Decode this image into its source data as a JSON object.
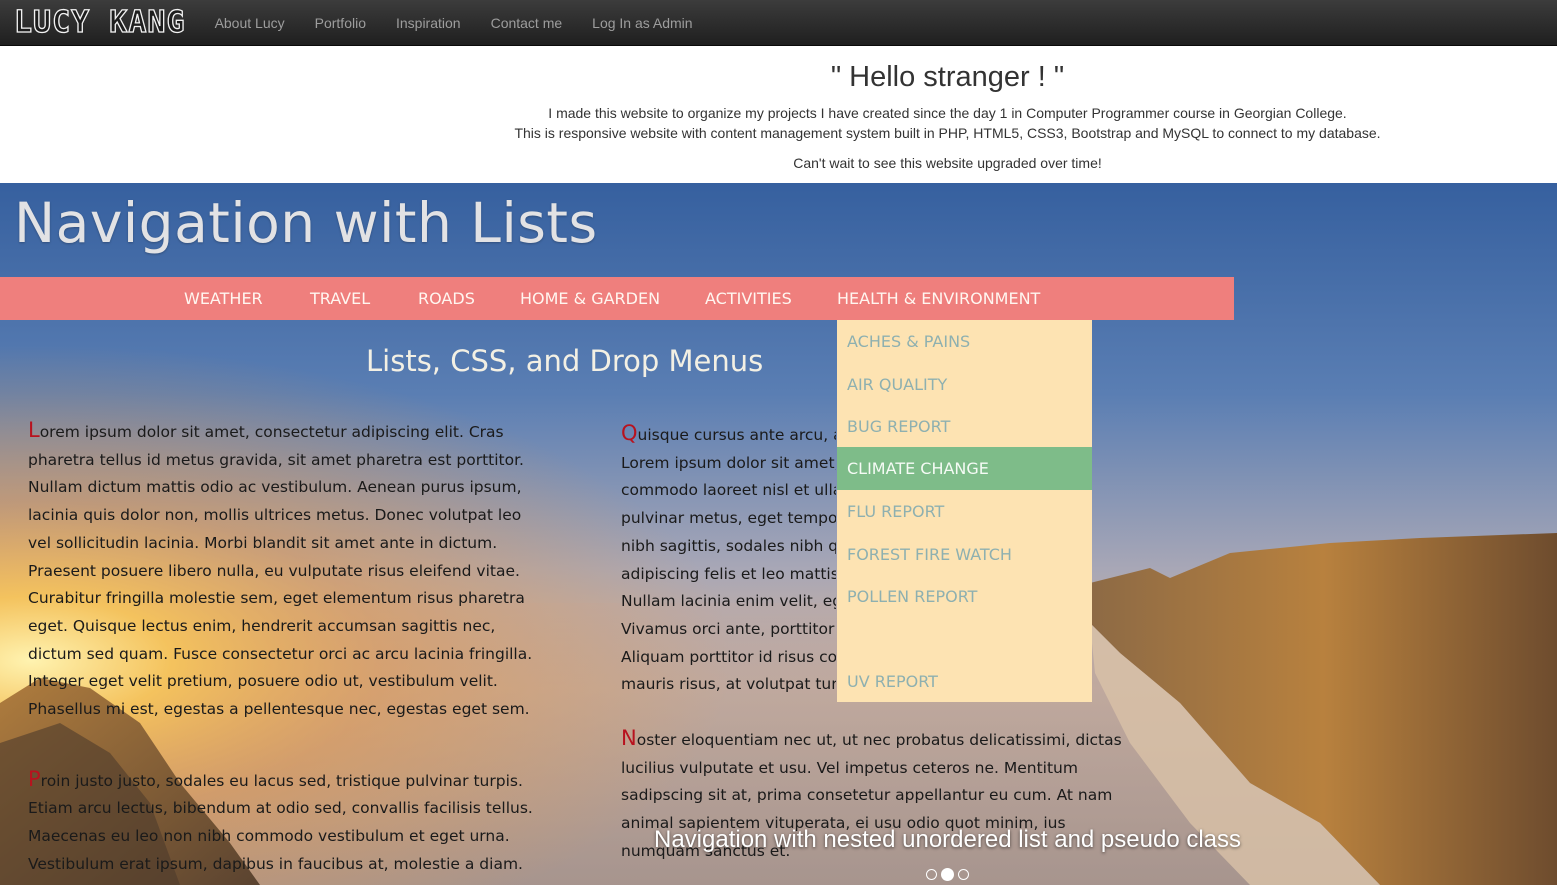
{
  "navbar": {
    "brand": "LUCY KANG",
    "links": [
      "About Lucy",
      "Portfolio",
      "Inspiration",
      "Contact me",
      "Log In as Admin"
    ]
  },
  "intro": {
    "heading": "\" Hello stranger ! \"",
    "line1": "I made this website to organize my projects I have created since the day 1 in Computer Programmer course in Georgian College.",
    "line2": "This is responsive website with content management system built in PHP, HTML5, CSS3, Bootstrap and MySQL to connect to my database.",
    "line3": "Can't wait to see this website upgraded over time!"
  },
  "slide": {
    "title": "Navigation with Lists",
    "menu": [
      "WEATHER",
      "TRAVEL",
      "ROADS",
      "HOME & GARDEN",
      "ACTIVITIES",
      "HEALTH & ENVIRONMENT"
    ],
    "dropdown": [
      "ACHES & PAINS",
      "AIR QUALITY",
      "BUG REPORT",
      "CLIMATE CHANGE",
      "FLU REPORT",
      "FOREST FIRE WATCH",
      "POLLEN REPORT",
      "UV REPORT"
    ],
    "subheading": "Lists, CSS, and Drop Menus",
    "para1": {
      "drop": "L",
      "lines": [
        "orem ipsum dolor sit amet, consectetur adipiscing elit. Cras",
        "pharetra tellus id metus gravida, sit amet pharetra est porttitor.",
        "Nullam dictum mattis odio ac vestibulum. Aenean purus ipsum,",
        "lacinia quis dolor non, mollis ultrices metus. Donec volutpat leo",
        "vel sollicitudin lacinia. Morbi blandit sit amet ante in dictum.",
        "Praesent posuere libero nulla, eu vulputate risus eleifend vitae.",
        "Curabitur fringilla molestie sem, eget elementum risus pharetra",
        "eget. Quisque lectus enim, hendrerit accumsan sagittis nec,",
        "dictum sed quam. Fusce consectetur orci ac arcu lacinia fringilla.",
        "Integer eget velit pretium, posuere odio ut, vestibulum velit.",
        "Phasellus mi est, egestas a pellentesque nec, egestas eget sem."
      ]
    },
    "para2": {
      "drop": "P",
      "lines": [
        "roin justo justo, sodales eu lacus sed, tristique pulvinar turpis.",
        "Etiam arcu lectus, bibendum at odio sed, convallis facilisis tellus.",
        "Maecenas eu leo non nibh commodo vestibulum et eget urna.",
        "Vestibulum erat ipsum, dapibus in faucibus at, molestie a diam."
      ]
    },
    "para3": {
      "drop": "Q",
      "lines": [
        "uisque cursus ante arcu, ac",
        "Lorem ipsum dolor sit amet,",
        "commodo laoreet nisl et ulla",
        "pulvinar metus, eget tempor",
        "nibh sagittis, sodales nibh qu",
        "adipiscing felis et leo mattis,",
        "Nullam lacinia enim velit, ege",
        "Vivamus orci ante, porttitor u",
        "Aliquam porttitor id risus cor",
        "mauris risus, at volutpat turp"
      ]
    },
    "para4": {
      "drop": "N",
      "lines": [
        "oster eloquentiam nec ut, ut nec probatus delicatissimi, dictas",
        "lucilius vulputate et usu. Vel impetus ceteros ne. Mentitum",
        "sadipscing sit at, prima consetetur appellantur eu cum. At nam",
        "animal sapientem vituperata, ei usu odio quot minim, ius",
        "numquam sanctus et."
      ]
    },
    "caption": "Navigation with nested unordered list and pseudo class",
    "indicators": 3,
    "active_indicator": 1
  },
  "colors": {
    "menubar": "#ef7f7d",
    "dropdown_bg": "#fde3b2",
    "dropdown_active": "#7ebc89",
    "dropcap": "#b8121e"
  }
}
